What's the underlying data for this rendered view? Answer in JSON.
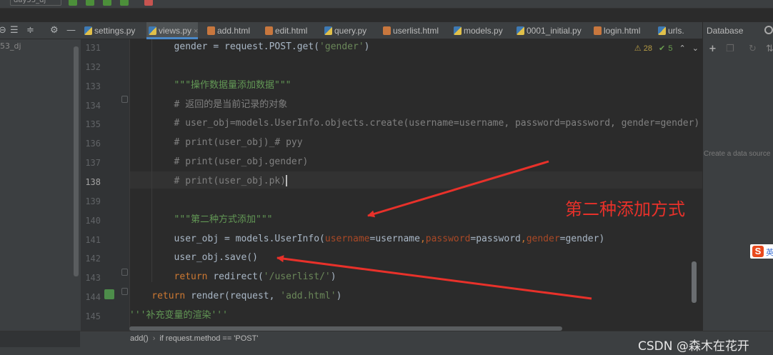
{
  "toolbar": {
    "project_dropdown": "day53_dj"
  },
  "left_panel": {
    "project_label": "53_dj"
  },
  "tabs": [
    {
      "label": "settings.py",
      "kind": "py",
      "active": false
    },
    {
      "label": "views.py",
      "kind": "py",
      "active": true
    },
    {
      "label": "add.html",
      "kind": "html",
      "active": false
    },
    {
      "label": "edit.html",
      "kind": "html",
      "active": false
    },
    {
      "label": "query.py",
      "kind": "py",
      "active": false
    },
    {
      "label": "userlist.html",
      "kind": "html",
      "active": false
    },
    {
      "label": "models.py",
      "kind": "py",
      "active": false
    },
    {
      "label": "0001_initial.py",
      "kind": "py",
      "active": false
    },
    {
      "label": "login.html",
      "kind": "html",
      "active": false
    },
    {
      "label": "urls.",
      "kind": "py",
      "active": false
    }
  ],
  "database_panel": {
    "title": "Database",
    "hint": "Create a data source"
  },
  "inspection": {
    "warnings": "28",
    "ok": "5"
  },
  "editor": {
    "current_line": "138",
    "lines": [
      {
        "num": "131",
        "indent": 8,
        "code": [
          [
            "",
            "gender = request.POST.get("
          ],
          [
            "str",
            "'gender'"
          ],
          [
            "",
            ")"
          ]
        ]
      },
      {
        "num": "132",
        "indent": 0,
        "code": []
      },
      {
        "num": "133",
        "indent": 8,
        "code": [
          [
            "doc",
            "\"\"\"操作数据量添加数据\"\"\""
          ]
        ]
      },
      {
        "num": "134",
        "indent": 8,
        "code": [
          [
            "cmt",
            "# 返回的是当前记录的对象"
          ]
        ]
      },
      {
        "num": "135",
        "indent": 8,
        "code": [
          [
            "cmt",
            "# user_obj=models.UserInfo.objects.create(username=username, password=password, gender=gender)"
          ]
        ]
      },
      {
        "num": "136",
        "indent": 8,
        "code": [
          [
            "cmt",
            "# print(user_obj)_# pyy"
          ]
        ]
      },
      {
        "num": "137",
        "indent": 8,
        "code": [
          [
            "cmt",
            "# print(user_obj.gender)"
          ]
        ]
      },
      {
        "num": "138",
        "indent": 8,
        "code": [
          [
            "cmt",
            "# print(user_obj.pk)"
          ]
        ]
      },
      {
        "num": "139",
        "indent": 0,
        "code": []
      },
      {
        "num": "140",
        "indent": 8,
        "code": [
          [
            "doc",
            "\"\"\"第二种方式添加\"\"\""
          ]
        ]
      },
      {
        "num": "141",
        "indent": 8,
        "code": [
          [
            "",
            "user_obj = models.UserInfo("
          ],
          [
            "param",
            "username"
          ],
          [
            "",
            "=username"
          ],
          [
            "kw",
            ","
          ],
          [
            "param",
            "password"
          ],
          [
            "",
            "=password"
          ],
          [
            "kw",
            ","
          ],
          [
            "param",
            "gender"
          ],
          [
            "",
            "=gender)"
          ]
        ]
      },
      {
        "num": "142",
        "indent": 8,
        "code": [
          [
            "",
            "user_obj.save()"
          ]
        ]
      },
      {
        "num": "143",
        "indent": 8,
        "code": [
          [
            "kw",
            "return "
          ],
          [
            "",
            "redirect("
          ],
          [
            "str",
            "'/userlist/'"
          ],
          [
            "",
            ")"
          ]
        ]
      },
      {
        "num": "144",
        "indent": 4,
        "code": [
          [
            "kw",
            "return "
          ],
          [
            "",
            "render(request, "
          ],
          [
            "str",
            "'add.html'"
          ],
          [
            "",
            ")"
          ]
        ]
      },
      {
        "num": "145",
        "indent": 0,
        "code": [
          [
            "doc",
            "'''补充变量的渲染'''"
          ]
        ]
      }
    ]
  },
  "status": {
    "breadcrumb": [
      "add()",
      "if request.method == 'POST'"
    ],
    "watermark": "CSDN @森木在花开"
  },
  "annotation": {
    "text": "第二种添加方式",
    "color": "#e8312a"
  }
}
